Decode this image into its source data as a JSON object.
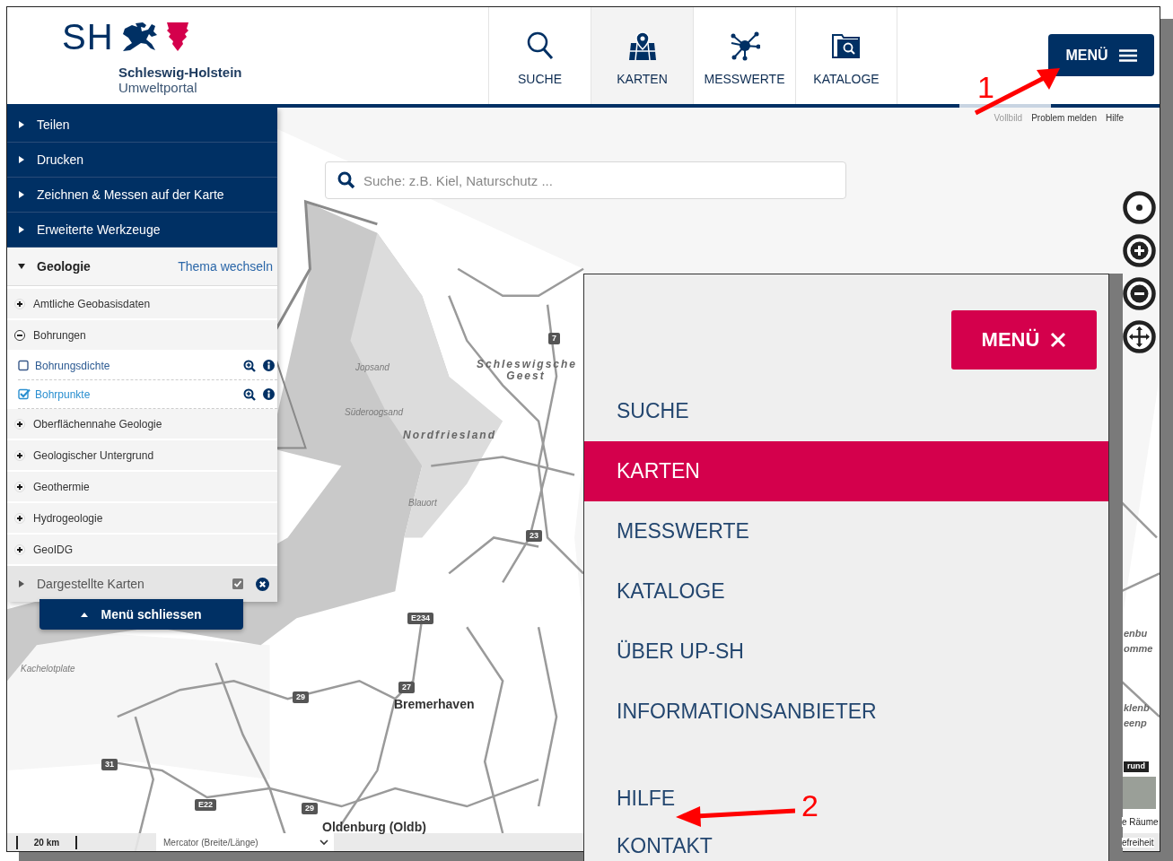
{
  "header": {
    "logo": {
      "mark": "SH",
      "title": "Schleswig-Holstein",
      "subtitle": "Umweltportal"
    },
    "nav": [
      {
        "label": "SUCHE",
        "selected": false
      },
      {
        "label": "KARTEN",
        "selected": true
      },
      {
        "label": "MESSWERTE",
        "selected": false
      },
      {
        "label": "KATALOGE",
        "selected": false
      }
    ],
    "menu_button": "MENÜ"
  },
  "top_links": [
    {
      "label": "Vollbild",
      "disabled": true
    },
    {
      "label": "Problem melden",
      "disabled": false
    },
    {
      "label": "Hilfe",
      "disabled": false
    }
  ],
  "search": {
    "placeholder": "Suche: z.B. Kiel, Naturschutz ..."
  },
  "sidebar": {
    "tools": [
      {
        "label": "Teilen",
        "expanded": false
      },
      {
        "label": "Drucken",
        "expanded": false
      },
      {
        "label": "Zeichnen & Messen auf der Karte",
        "expanded": false
      },
      {
        "label": "Erweiterte Werkzeuge",
        "expanded": false
      }
    ],
    "theme": {
      "title": "Geologie",
      "expanded": true,
      "switch_link": "Thema wechseln"
    },
    "layers": [
      {
        "label": "Amtliche Geobasisdaten",
        "expanded": false
      },
      {
        "label": "Bohrungen",
        "expanded": true,
        "children": [
          {
            "label": "Bohrungsdichte",
            "checked": false
          },
          {
            "label": "Bohrpunkte",
            "checked": true
          }
        ]
      },
      {
        "label": "Oberflächennahe Geologie",
        "expanded": false
      },
      {
        "label": "Geologischer Untergrund",
        "expanded": false
      },
      {
        "label": "Geothermie",
        "expanded": false
      },
      {
        "label": "Hydrogeologie",
        "expanded": false
      },
      {
        "label": "GeoIDG",
        "expanded": false
      }
    ],
    "shown_maps": {
      "label": "Dargestellte Karten",
      "expanded": false,
      "checked": true
    },
    "close_button": "Menü schliessen"
  },
  "map": {
    "labels": [
      {
        "text": "Jopsand",
        "kind": "area"
      },
      {
        "text": "Süderoogsand",
        "kind": "area"
      },
      {
        "text": "Schleswigsche Geest",
        "kind": "region"
      },
      {
        "text": "Nordfriesland",
        "kind": "region"
      },
      {
        "text": "Blauort",
        "kind": "area"
      },
      {
        "text": "Kachelotplate",
        "kind": "area"
      },
      {
        "text": "Bremerhaven",
        "kind": "city"
      },
      {
        "text": "Oldenburg (Oldb)",
        "kind": "city"
      },
      {
        "text": "enbu",
        "kind": "region"
      },
      {
        "text": "omme",
        "kind": "region"
      },
      {
        "text": "klenb",
        "kind": "region"
      },
      {
        "text": "eenp",
        "kind": "region"
      },
      {
        "text": "rund",
        "kind": "tile"
      },
      {
        "text": "e Räume",
        "kind": "plain"
      },
      {
        "text": "efreiheit",
        "kind": "plain"
      }
    ],
    "road_shields": [
      "7",
      "23",
      "E234",
      "27",
      "29",
      "31",
      "E22",
      "29"
    ]
  },
  "status_bar": {
    "scale": "20 km",
    "projection": "Mercator (Breite/Länge)"
  },
  "overlay_menu": {
    "close_button": "MENÜ",
    "items": [
      {
        "label": "SUCHE",
        "selected": false
      },
      {
        "label": "KARTEN",
        "selected": true
      },
      {
        "label": "MESSWERTE",
        "selected": false
      },
      {
        "label": "KATALOGE",
        "selected": false
      },
      {
        "label": "ÜBER UP-SH",
        "selected": false
      },
      {
        "label": "INFORMATIONSANBIETER",
        "selected": false
      },
      {
        "label": "HILFE",
        "selected": false
      },
      {
        "label": "KONTAKT",
        "selected": false
      }
    ]
  },
  "annotations": [
    {
      "label": "1"
    },
    {
      "label": "2"
    }
  ]
}
